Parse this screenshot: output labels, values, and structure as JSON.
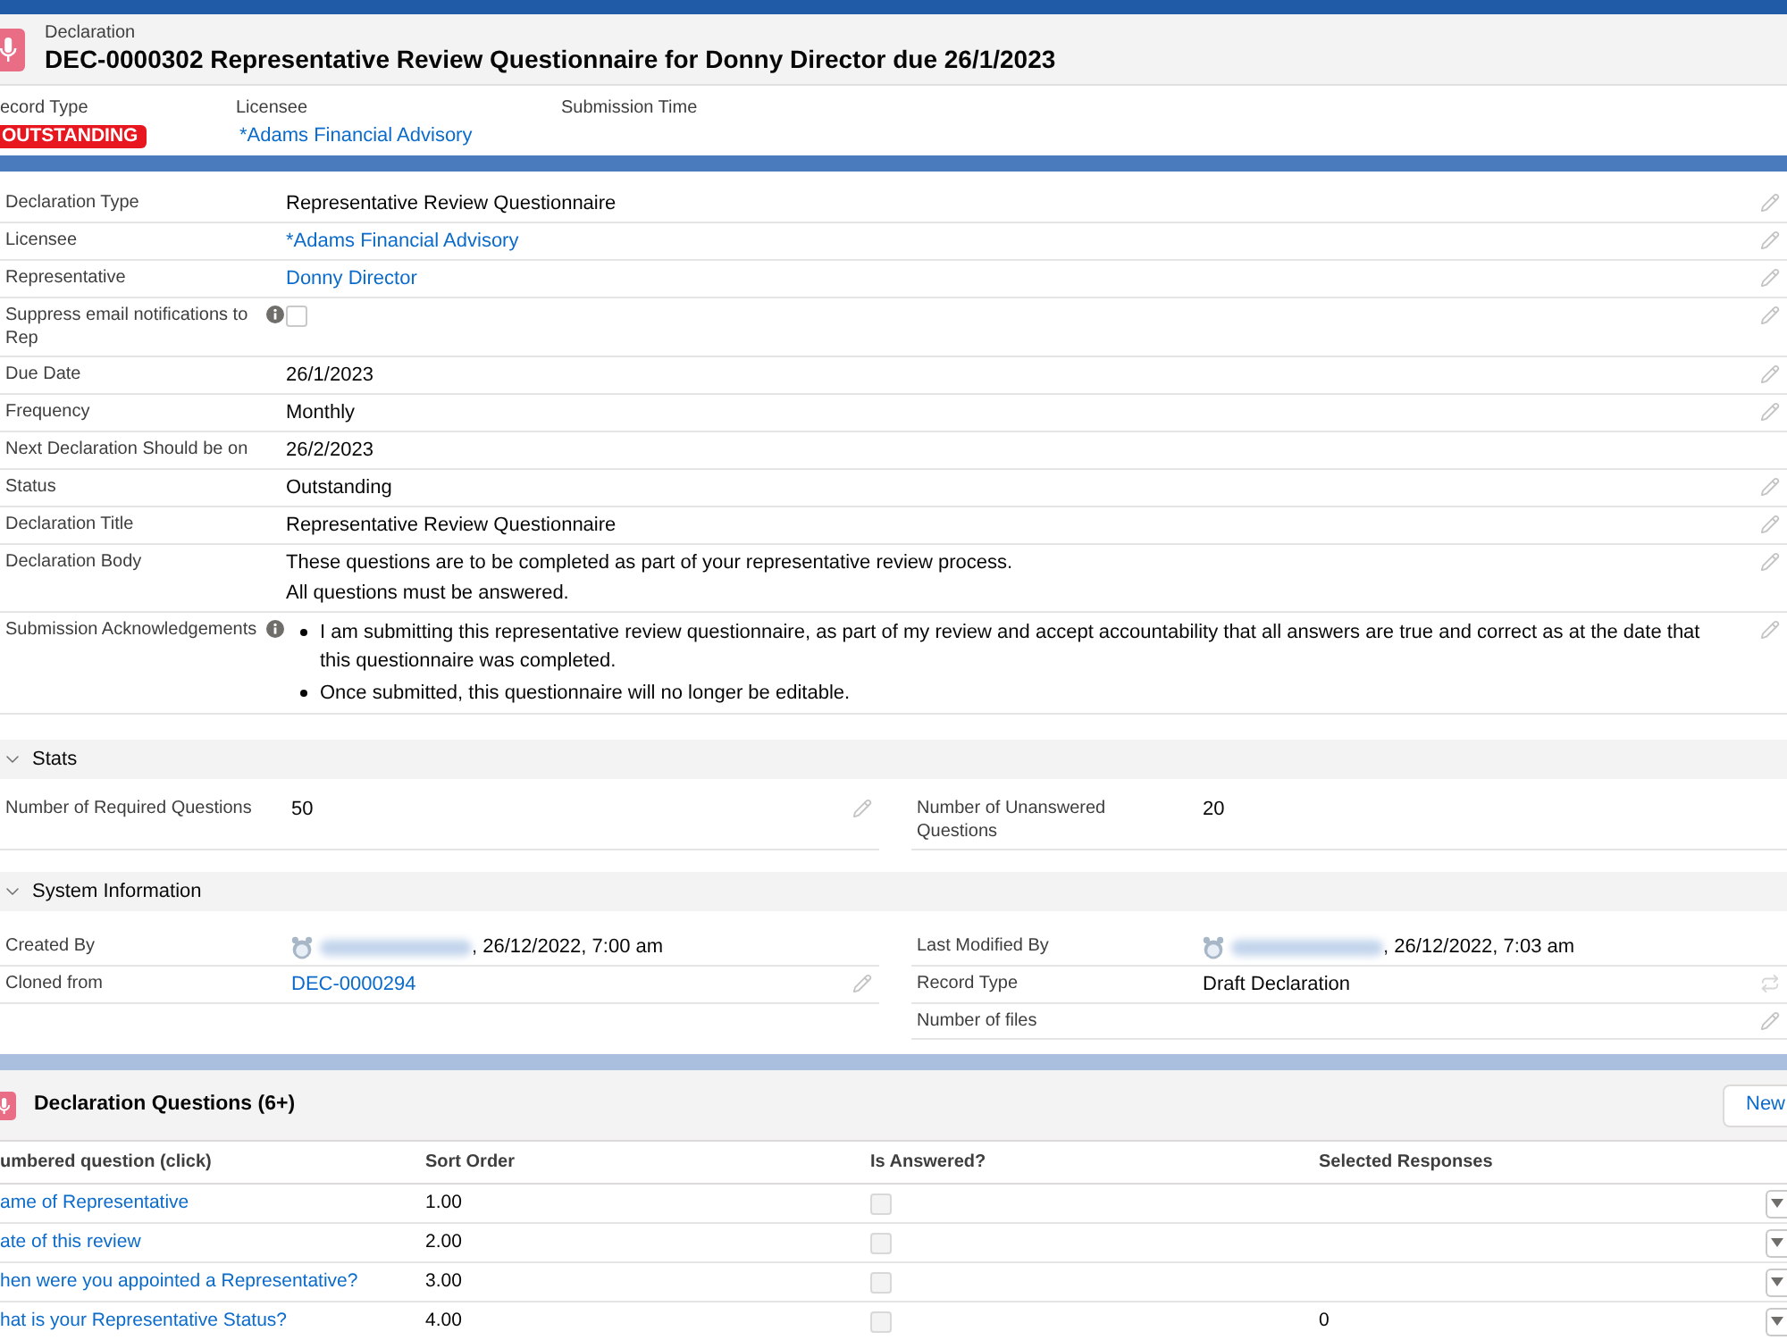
{
  "record_header": {
    "object_type": "Declaration",
    "title": "DEC-0000302 Representative Review Questionnaire for Donny Director due 26/1/2023"
  },
  "highlights": [
    {
      "label": "ecord Type",
      "kind": "badge",
      "value": "OUTSTANDING"
    },
    {
      "label": "Licensee",
      "kind": "link",
      "value": "*Adams Financial Advisory"
    },
    {
      "label": "Submission Time",
      "kind": "empty"
    }
  ],
  "details": [
    {
      "label": "Declaration Type",
      "help": false,
      "kind": "text",
      "value": "Representative Review Questionnaire",
      "editable": true
    },
    {
      "label": "Licensee",
      "help": false,
      "kind": "link",
      "value": "*Adams Financial Advisory",
      "editable": true
    },
    {
      "label": "Representative",
      "help": false,
      "kind": "link",
      "value": "Donny Director",
      "editable": true
    },
    {
      "label": "Suppress email notifications to Rep",
      "help": true,
      "kind": "checkbox",
      "checked": false,
      "editable": true
    },
    {
      "label": "Due Date",
      "help": false,
      "kind": "text",
      "value": "26/1/2023",
      "editable": true
    },
    {
      "label": "Frequency",
      "help": false,
      "kind": "text",
      "value": "Monthly",
      "editable": true
    },
    {
      "label": "Next Declaration Should be on",
      "help": false,
      "kind": "text",
      "value": "26/2/2023",
      "editable": false
    },
    {
      "label": "Status",
      "help": false,
      "kind": "text",
      "value": "Outstanding",
      "editable": true
    },
    {
      "label": "Declaration Title",
      "help": false,
      "kind": "text",
      "value": "Representative Review Questionnaire",
      "editable": true
    },
    {
      "label": "Declaration Body",
      "help": false,
      "kind": "lines",
      "lines": [
        "These questions are to be completed as part of your representative review process.",
        "All questions must be answered."
      ],
      "editable": true
    },
    {
      "label": "Submission Acknowledgements",
      "help": true,
      "kind": "bullets",
      "items": [
        "I am submitting this representative review questionnaire, as part of my review and accept accountability that all answers are true and correct as at the date that this questionnaire was completed.",
        "Once submitted, this questionnaire will no longer be editable."
      ],
      "editable": true
    }
  ],
  "sections": [
    {
      "title": "Stats",
      "expanded": true,
      "left": [
        {
          "label": "Number of Required Questions",
          "kind": "text",
          "value": "50",
          "editable": true,
          "changeable": false
        }
      ],
      "right": [
        {
          "label": "Number of Unanswered Questions",
          "kind": "text",
          "value": "20",
          "editable": false,
          "changeable": false
        }
      ]
    },
    {
      "title": "System Information",
      "expanded": true,
      "left": [
        {
          "label": "Created By",
          "kind": "user",
          "value": ", 26/12/2022, 7:00 am",
          "editable": false,
          "changeable": false
        },
        {
          "label": "Cloned from",
          "kind": "link",
          "value": "DEC-0000294",
          "editable": true,
          "changeable": false
        }
      ],
      "right": [
        {
          "label": "Last Modified By",
          "kind": "user",
          "value": ", 26/12/2022, 7:03 am",
          "editable": false,
          "changeable": false
        },
        {
          "label": "Record Type",
          "kind": "text",
          "value": "Draft Declaration",
          "editable": false,
          "changeable": true
        },
        {
          "label": "Number of files",
          "kind": "empty",
          "editable": true,
          "changeable": false
        }
      ]
    }
  ],
  "related_list": {
    "title": "Declaration Questions (6+)",
    "button": "New",
    "columns": [
      "umbered question (click)",
      "Sort Order",
      "Is Answered?",
      "Selected Responses"
    ],
    "rows": [
      {
        "question": "ame of Representative",
        "sort_order": "1.00",
        "answered": false
      },
      {
        "question": "ate of this review",
        "sort_order": "2.00",
        "answered": false
      },
      {
        "question": "hen were you appointed a Representative?",
        "sort_order": "3.00",
        "answered": false
      },
      {
        "question": "hat is your Representative Status?",
        "sort_order": "4.00",
        "answered": false,
        "selected_responses": "0"
      }
    ]
  }
}
